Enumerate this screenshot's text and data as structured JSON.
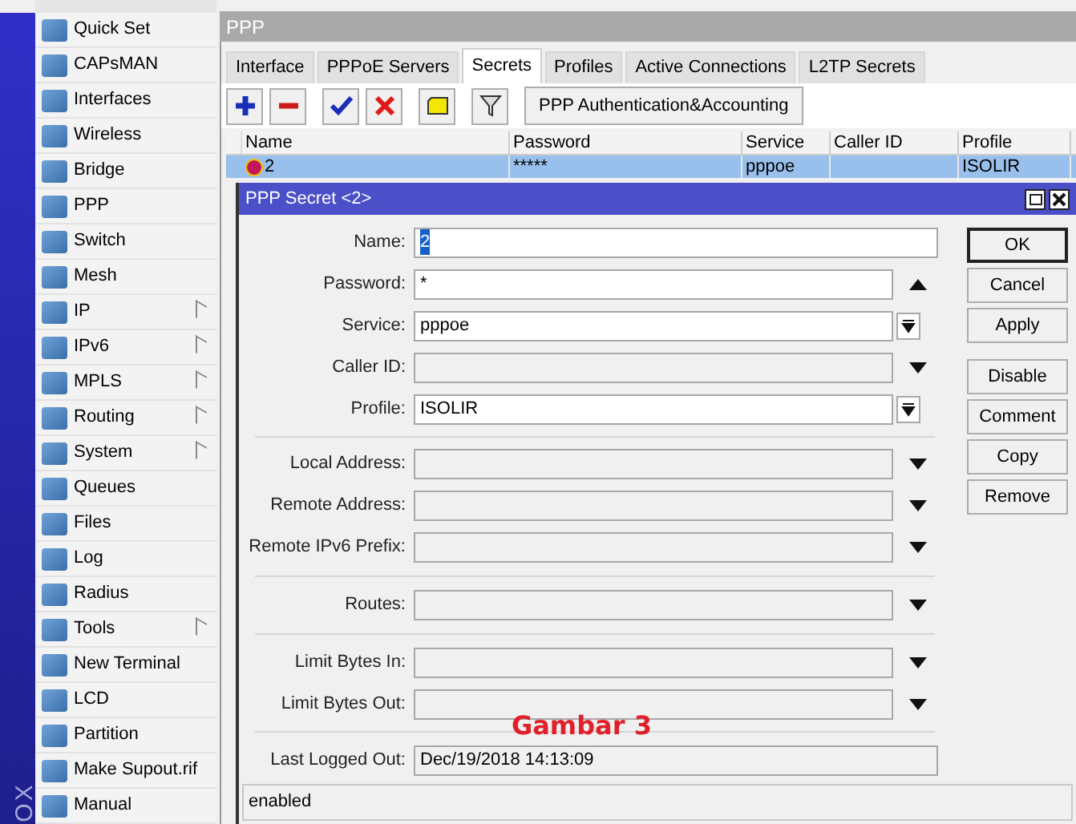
{
  "sidebar": {
    "vertical_label": "OX",
    "items": [
      {
        "label": "Quick Set",
        "has_submenu": false
      },
      {
        "label": "CAPsMAN",
        "has_submenu": false
      },
      {
        "label": "Interfaces",
        "has_submenu": false
      },
      {
        "label": "Wireless",
        "has_submenu": false
      },
      {
        "label": "Bridge",
        "has_submenu": false
      },
      {
        "label": "PPP",
        "has_submenu": false
      },
      {
        "label": "Switch",
        "has_submenu": false
      },
      {
        "label": "Mesh",
        "has_submenu": false
      },
      {
        "label": "IP",
        "has_submenu": true
      },
      {
        "label": "IPv6",
        "has_submenu": true
      },
      {
        "label": "MPLS",
        "has_submenu": true
      },
      {
        "label": "Routing",
        "has_submenu": true
      },
      {
        "label": "System",
        "has_submenu": true
      },
      {
        "label": "Queues",
        "has_submenu": false
      },
      {
        "label": "Files",
        "has_submenu": false
      },
      {
        "label": "Log",
        "has_submenu": false
      },
      {
        "label": "Radius",
        "has_submenu": false
      },
      {
        "label": "Tools",
        "has_submenu": true
      },
      {
        "label": "New Terminal",
        "has_submenu": false
      },
      {
        "label": "LCD",
        "has_submenu": false
      },
      {
        "label": "Partition",
        "has_submenu": false
      },
      {
        "label": "Make Supout.rif",
        "has_submenu": false
      },
      {
        "label": "Manual",
        "has_submenu": false
      }
    ]
  },
  "ppp_window": {
    "title": "PPP",
    "tabs": [
      {
        "label": "Interface",
        "selected": false
      },
      {
        "label": "PPPoE Servers",
        "selected": false
      },
      {
        "label": "Secrets",
        "selected": true
      },
      {
        "label": "Profiles",
        "selected": false
      },
      {
        "label": "Active Connections",
        "selected": false
      },
      {
        "label": "L2TP Secrets",
        "selected": false
      }
    ],
    "toolbar": [
      {
        "kind": "add"
      },
      {
        "kind": "remove"
      },
      {
        "kind": "enable"
      },
      {
        "kind": "disable"
      },
      {
        "kind": "comment"
      },
      {
        "kind": "filter"
      },
      {
        "kind": "text",
        "label": "PPP Authentication&Accounting"
      }
    ],
    "table": {
      "columns": [
        "Name",
        "Password",
        "Service",
        "Caller ID",
        "Profile"
      ],
      "rows": [
        {
          "selected": true,
          "cells": [
            "2",
            "*****",
            "pppoe",
            "",
            "ISOLIR"
          ]
        }
      ]
    }
  },
  "dialog": {
    "title": "PPP Secret <2>",
    "sections": [
      [
        {
          "kind": "plain",
          "label": "Name:",
          "value": "2",
          "enabled": true,
          "value_selected": true
        },
        {
          "kind": "collapsible",
          "label": "Password:",
          "value": "*",
          "enabled": true
        },
        {
          "kind": "select",
          "label": "Service:",
          "value": "pppoe",
          "enabled": true
        },
        {
          "kind": "expandable",
          "label": "Caller ID:",
          "enabled": false
        },
        {
          "kind": "select",
          "label": "Profile:",
          "value": "ISOLIR",
          "enabled": true
        }
      ],
      [
        {
          "kind": "expandable",
          "label": "Local Address:",
          "enabled": false
        },
        {
          "kind": "expandable",
          "label": "Remote Address:",
          "enabled": false
        },
        {
          "kind": "expandable",
          "label": "Remote IPv6 Prefix:",
          "enabled": false
        }
      ],
      [
        {
          "kind": "expandable",
          "label": "Routes:",
          "enabled": false
        }
      ],
      [
        {
          "kind": "expandable",
          "label": "Limit Bytes In:",
          "enabled": false
        },
        {
          "kind": "expandable",
          "label": "Limit Bytes Out:",
          "enabled": false
        }
      ],
      [
        {
          "kind": "wide",
          "label": "Last Logged Out:",
          "value": "Dec/19/2018 14:13:09",
          "enabled": false
        }
      ]
    ],
    "button_groups": [
      [
        {
          "label": "OK",
          "default": true
        },
        {
          "label": "Cancel",
          "default": false
        },
        {
          "label": "Apply",
          "default": false
        }
      ],
      [
        {
          "label": "Disable",
          "default": false
        },
        {
          "label": "Comment",
          "default": false
        },
        {
          "label": "Copy",
          "default": false
        },
        {
          "label": "Remove",
          "default": false
        }
      ]
    ],
    "status": "enabled"
  },
  "annotation": "Gambar 3"
}
